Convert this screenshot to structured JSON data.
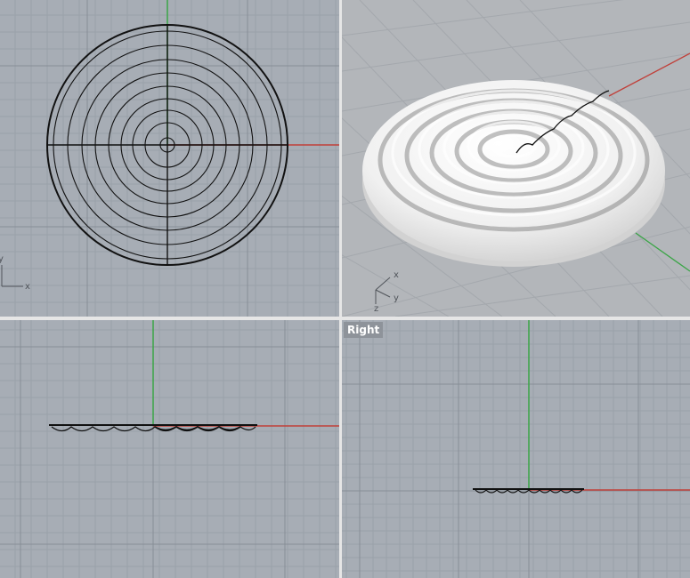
{
  "viewports": {
    "top": {
      "label": "",
      "axis_x": "x",
      "axis_y": "y"
    },
    "perspective": {
      "label": "",
      "axis_x": "x",
      "axis_y": "y",
      "axis_z": "z"
    },
    "front": {
      "label": ""
    },
    "right": {
      "label": "Right"
    }
  },
  "colors": {
    "viewport_bg": "#a7adb5",
    "grid_minor": "#9aa1a9",
    "grid_major": "#878e97",
    "x_axis": "#c0403a",
    "y_axis": "#3aa546",
    "curve": "#111111",
    "separator": "#e6e6e6"
  },
  "icons": {
    "axis_widget_top": "2d-axis-icon",
    "axis_widget_perspective": "3d-axis-icon"
  }
}
